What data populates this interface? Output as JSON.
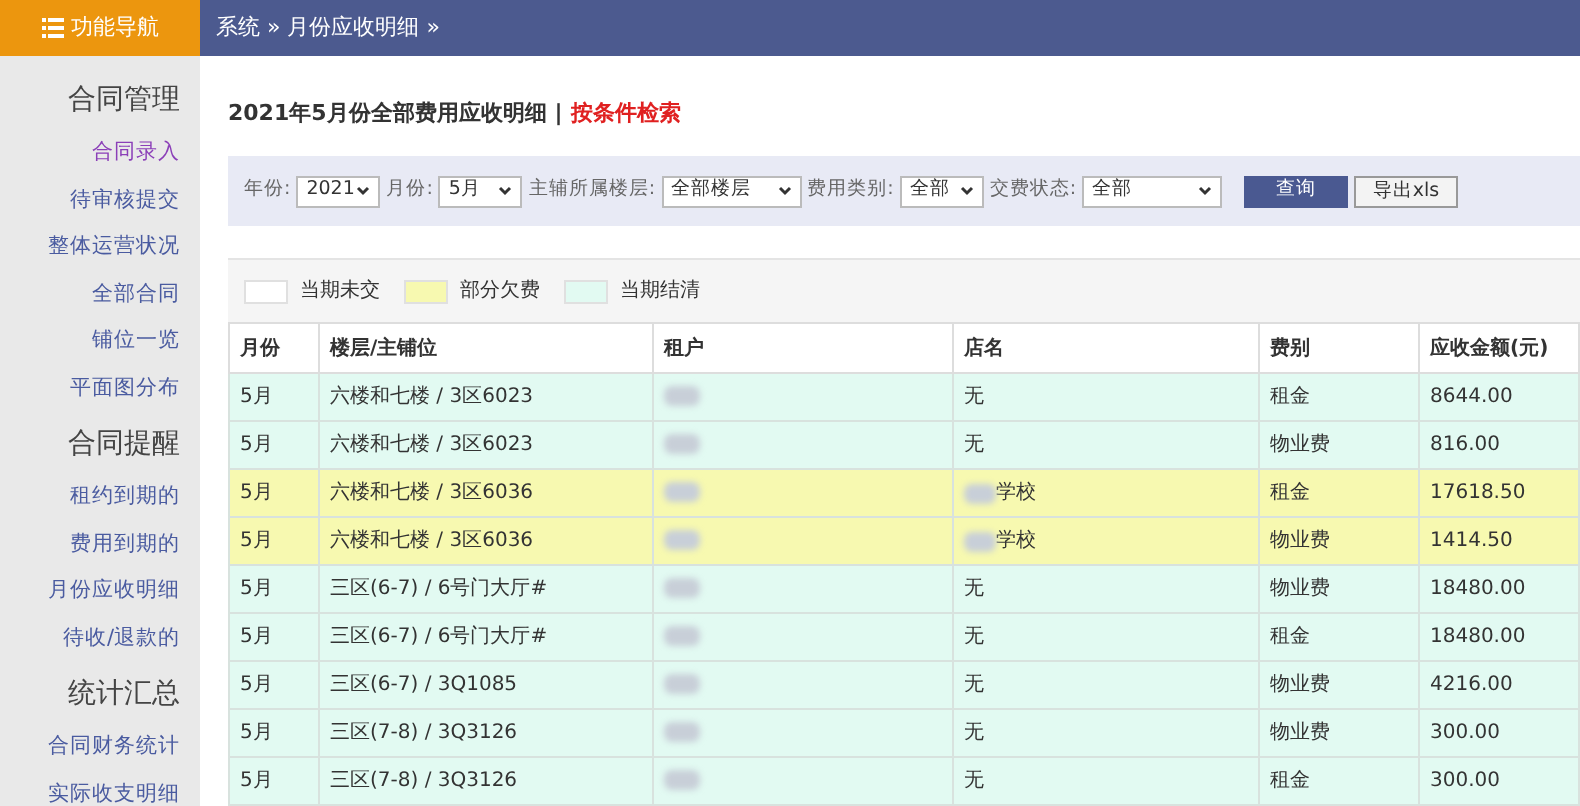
{
  "sidebar": {
    "title": "功能导航",
    "sections": [
      {
        "heading": "合同管理",
        "items": [
          {
            "label": "合同录入",
            "selected": true
          },
          {
            "label": "待审核提交",
            "selected": false
          },
          {
            "label": "整体运营状况",
            "selected": false
          },
          {
            "label": "全部合同",
            "selected": false
          },
          {
            "label": "铺位一览",
            "selected": false
          },
          {
            "label": "平面图分布",
            "selected": false
          }
        ]
      },
      {
        "heading": "合同提醒",
        "items": [
          {
            "label": "租约到期的",
            "selected": false
          },
          {
            "label": "费用到期的",
            "selected": false
          },
          {
            "label": "月份应收明细",
            "selected": false
          },
          {
            "label": "待收/退款的",
            "selected": false
          }
        ]
      },
      {
        "heading": "统计汇总",
        "items": [
          {
            "label": "合同财务统计",
            "selected": false
          },
          {
            "label": "实际收支明细",
            "selected": false
          }
        ]
      }
    ]
  },
  "breadcrumb": {
    "items": [
      "系统",
      "月份应收明细"
    ],
    "separator": "»"
  },
  "page_title": "2021年5月份全部费用应收明细",
  "title_separator": "|",
  "search_link": "按条件检索",
  "filters": [
    {
      "label": "年份:",
      "value": "2021"
    },
    {
      "label": "月份:",
      "value": "5月"
    },
    {
      "label": "主辅所属楼层:",
      "value": "全部楼层"
    },
    {
      "label": "费用类别:",
      "value": "全部"
    },
    {
      "label": "交费状态:",
      "value": "全部"
    }
  ],
  "buttons": [
    {
      "label": "查询",
      "kind": "primary"
    },
    {
      "label": "导出xls",
      "kind": "secondary"
    }
  ],
  "legend": [
    {
      "label": "当期未交",
      "color": "#ffffff"
    },
    {
      "label": "部分欠费",
      "color": "#f7f9b0"
    },
    {
      "label": "当期结清",
      "color": "#e2faf2"
    }
  ],
  "table": {
    "columns": [
      "月份",
      "楼层/主铺位",
      "租户",
      "店名",
      "费别",
      "应收金额(元)"
    ],
    "rows": [
      {
        "color": "#e2faf2",
        "month": "5月",
        "location": "六楼和七楼 / 3区6023",
        "store": "无",
        "store_redacted": false,
        "fee": "租金",
        "amount": "8644.00"
      },
      {
        "color": "#e2faf2",
        "month": "5月",
        "location": "六楼和七楼 / 3区6023",
        "store": "无",
        "store_redacted": false,
        "fee": "物业费",
        "amount": "816.00"
      },
      {
        "color": "#f7f9b0",
        "month": "5月",
        "location": "六楼和七楼 / 3区6036",
        "store": "学校",
        "store_redacted": true,
        "fee": "租金",
        "amount": "17618.50"
      },
      {
        "color": "#f7f9b0",
        "month": "5月",
        "location": "六楼和七楼 / 3区6036",
        "store": "学校",
        "store_redacted": true,
        "fee": "物业费",
        "amount": "1414.50"
      },
      {
        "color": "#e2faf2",
        "month": "5月",
        "location": "三区(6-7) / 6号门大厅#",
        "store": "无",
        "store_redacted": false,
        "fee": "物业费",
        "amount": "18480.00"
      },
      {
        "color": "#e2faf2",
        "month": "5月",
        "location": "三区(6-7) / 6号门大厅#",
        "store": "无",
        "store_redacted": false,
        "fee": "租金",
        "amount": "18480.00"
      },
      {
        "color": "#e2faf2",
        "month": "5月",
        "location": "三区(6-7) / 3Q1085",
        "store": "无",
        "store_redacted": false,
        "fee": "物业费",
        "amount": "4216.00"
      },
      {
        "color": "#e2faf2",
        "month": "5月",
        "location": "三区(7-8) / 3Q3126",
        "store": "无",
        "store_redacted": false,
        "fee": "物业费",
        "amount": "300.00"
      },
      {
        "color": "#e2faf2",
        "month": "5月",
        "location": "三区(7-8) / 3Q3126",
        "store": "无",
        "store_redacted": false,
        "fee": "租金",
        "amount": "300.00"
      }
    ]
  }
}
